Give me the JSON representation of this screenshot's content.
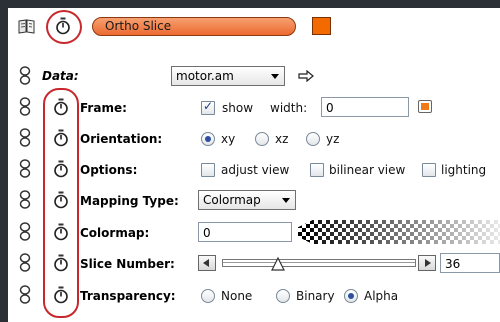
{
  "header": {
    "module_name": "Ortho Slice",
    "module_color": "#f07a34",
    "swatch_color": "#f36b00"
  },
  "data_row": {
    "label": "Data:",
    "value": "motor.am"
  },
  "frame": {
    "label": "Frame:",
    "show_label": "show",
    "show_checked": true,
    "width_label": "width:",
    "width_value": "0",
    "color": "#f07a1a"
  },
  "orientation": {
    "label": "Orientation:",
    "options": [
      "xy",
      "xz",
      "yz"
    ],
    "selected": "xy"
  },
  "options": {
    "label": "Options:",
    "items": [
      "adjust view",
      "bilinear view",
      "lighting"
    ]
  },
  "mapping_type": {
    "label": "Mapping Type:",
    "value": "Colormap"
  },
  "colormap": {
    "label": "Colormap:",
    "value": "0"
  },
  "slice_number": {
    "label": "Slice Number:",
    "value": "36",
    "fraction": 0.27
  },
  "transparency": {
    "label": "Transparency:",
    "options": [
      "None",
      "Binary",
      "Alpha"
    ],
    "selected": "Alpha"
  },
  "highlight_color": "#c8282d"
}
